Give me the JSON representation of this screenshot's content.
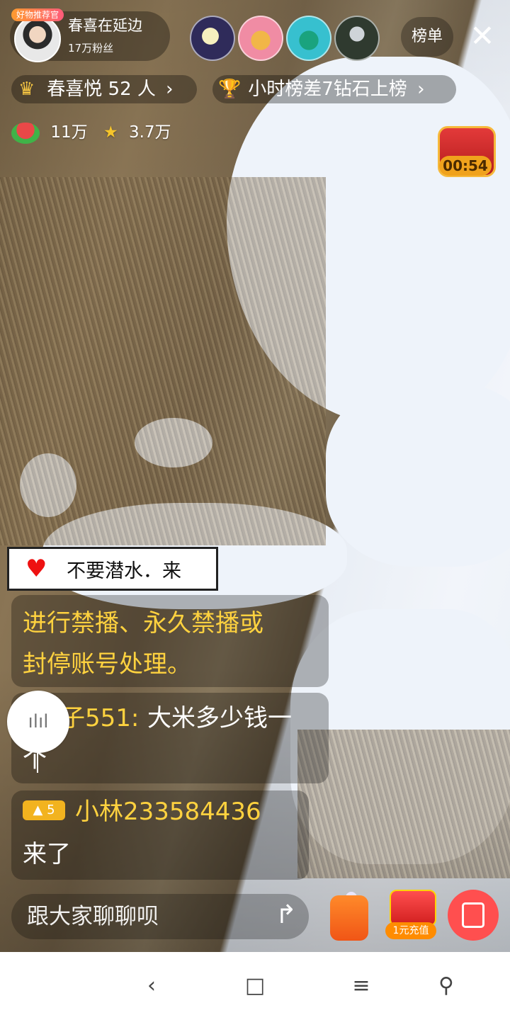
{
  "host": {
    "badge": "好物推荐官",
    "name": "春喜在延边",
    "fans": "17万粉丝"
  },
  "header": {
    "rank_label": "榜单",
    "close": "✕",
    "group_name": "春喜悦 52 人",
    "hour_rank": "小时榜差7钻石上榜",
    "stats": {
      "melon": "11万",
      "star": "3.7万"
    }
  },
  "chest": {
    "timer": "00:54"
  },
  "chat": {
    "sticker_text": "不要潜水．来",
    "system_line_1": "进行禁播、永久禁播或",
    "system_line_2": "封停账号处理。",
    "msg2_user": "子551:",
    "msg2_text_1": "大米多少钱一",
    "msg2_text_2": "个",
    "msg3_level": "5",
    "msg3_user": "小林233584436",
    "msg3_text": "来了"
  },
  "bottom": {
    "input_placeholder": "跟大家聊聊呗",
    "recharge_label": "1元充值"
  },
  "sysnav": {
    "back": "‹",
    "home": "□",
    "menu": "≡",
    "accessibility": "⚲"
  },
  "colors": {
    "yellow_text": "#ffd23f",
    "gift": "#ff4f4f",
    "bag": "#ff6a1f"
  }
}
